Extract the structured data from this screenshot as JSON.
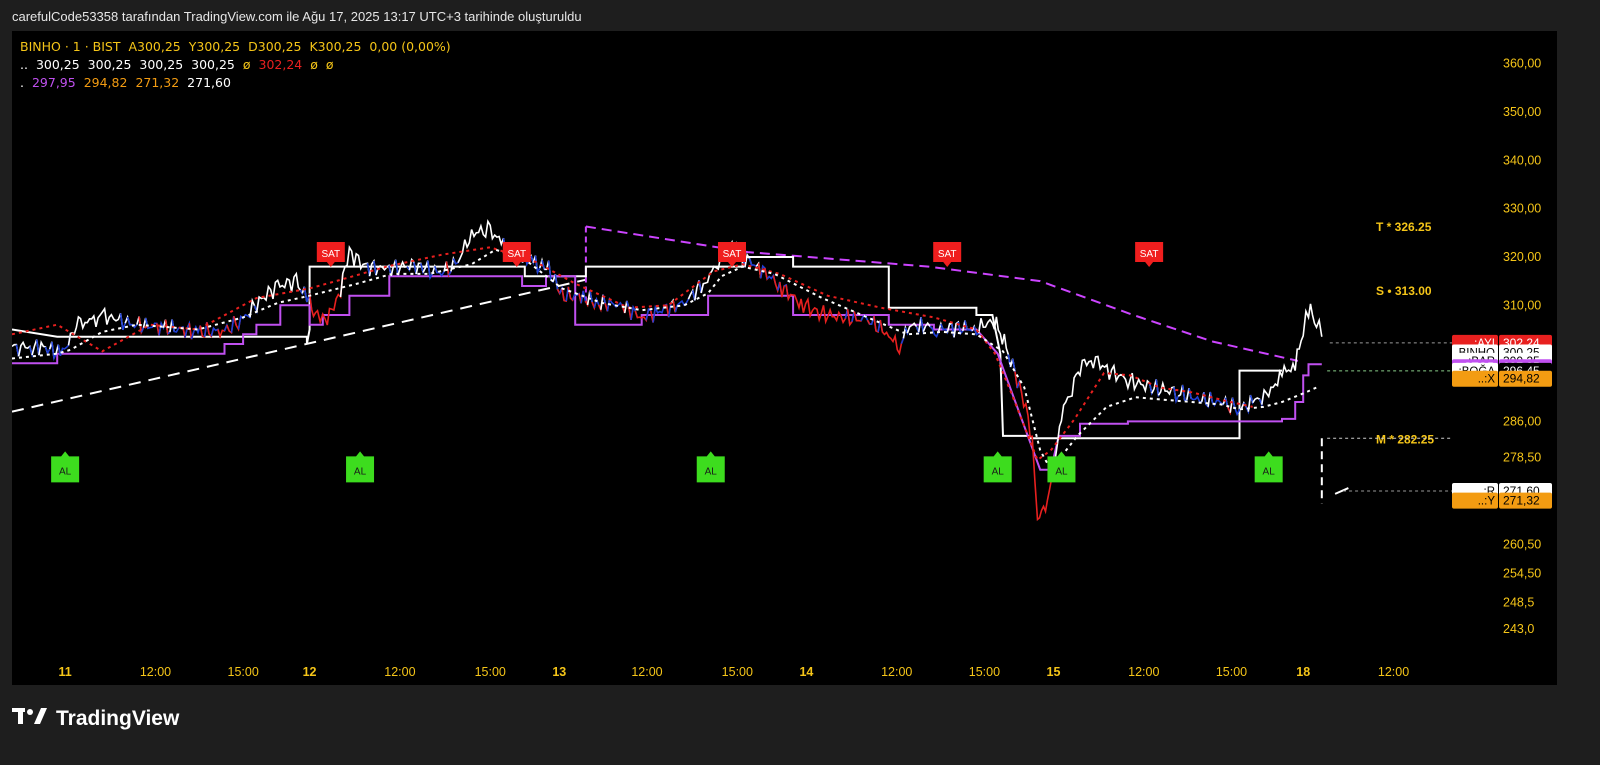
{
  "header": {
    "text": "carefulCode53358 tarafından TradingView.com ile Ağu 17, 2025 13:17 UTC+3 tarihinde oluşturuldu"
  },
  "legend": {
    "row1": {
      "symbol": "BINHO · 1 · BIST",
      "o": "A300,25",
      "h": "Y300,25",
      "l": "D300,25",
      "c": "K300,25",
      "chg": "0,00 (0,00%)"
    },
    "row2": {
      "prefix": "..",
      "v1": "300,25",
      "v2": "300,25",
      "v3": "300,25",
      "v4": "300,25",
      "na1": "ø",
      "v5": "302,24",
      "na2": "ø",
      "na3": "ø"
    },
    "row3": {
      "prefix": ".",
      "v1": "297,95",
      "v2": "294,82",
      "v3": "271,32",
      "v4": "271,60"
    }
  },
  "colors": {
    "up": "#ffffff",
    "down": "#e8201f",
    "neutral": "#1f3fd6",
    "stop": "#c050f0",
    "trend": "#cc44ff",
    "sell": "#f01e1e",
    "buy": "#3ddc1e",
    "yellow_text": "#f5c518",
    "orange": "#f39c12"
  },
  "brand": {
    "name": "TradingView",
    "icon": "tradingview-logo-icon"
  },
  "chart_data": {
    "type": "line",
    "symbol": "BINHO",
    "timeframe": "1",
    "exchange": "BIST",
    "ylim": [
      238.5,
      365.5
    ],
    "y_ticks": [
      "360,00",
      "350,00",
      "340,00",
      "330,00",
      "320,00",
      "310,00",
      "286,00",
      "278,50",
      "260,50",
      "254,50",
      "248,5",
      "243,0"
    ],
    "x_ticks": [
      "11",
      "12:00",
      "15:00",
      "12",
      "12:00",
      "15:00",
      "13",
      "12:00",
      "15:00",
      "14",
      "12:00",
      "15:00",
      "15",
      "12:00",
      "15:00",
      "18",
      "12:00"
    ],
    "x_tick_slots": [
      0.3,
      3.7,
      7,
      9.5,
      12.9,
      16.3,
      18.9,
      22.2,
      25.6,
      28.2,
      31.6,
      34.9,
      37.5,
      40.9,
      44.2,
      46.9,
      50.3
    ],
    "x_domain": [
      -1.7,
      52.5
    ],
    "price": [
      [
        -1.7,
        301.5
      ],
      [
        -1.2,
        300.8
      ],
      [
        -0.6,
        301.5
      ],
      [
        0.2,
        300.0
      ],
      [
        0.5,
        303.0
      ],
      [
        0.8,
        306.5
      ],
      [
        1.3,
        306.3
      ],
      [
        1.7,
        308.0
      ],
      [
        2.3,
        306.8
      ],
      [
        3.0,
        306.0
      ],
      [
        4.0,
        305.5
      ],
      [
        5.3,
        304.5
      ],
      [
        6.3,
        304.7
      ],
      [
        7.0,
        307.0
      ],
      [
        7.6,
        311.0
      ],
      [
        8.3,
        314.0
      ],
      [
        9.0,
        315.0
      ],
      [
        9.3,
        312.0
      ],
      [
        9.5,
        310.5
      ],
      [
        9.8,
        307.0
      ],
      [
        10.0,
        306.5
      ],
      [
        10.5,
        310.0
      ],
      [
        11.0,
        321.0
      ],
      [
        11.6,
        318.0
      ],
      [
        12.4,
        317.5
      ],
      [
        13.6,
        318.5
      ],
      [
        14.3,
        316.5
      ],
      [
        15.0,
        318.2
      ],
      [
        15.6,
        325.0
      ],
      [
        16.3,
        325.5
      ],
      [
        16.8,
        322.5
      ],
      [
        17.6,
        320.5
      ],
      [
        18.0,
        318.5
      ],
      [
        18.5,
        317.5
      ],
      [
        19.0,
        312.0
      ],
      [
        19.8,
        311.8
      ],
      [
        20.3,
        310.5
      ],
      [
        21.2,
        310.2
      ],
      [
        22.0,
        307.5
      ],
      [
        22.6,
        308.8
      ],
      [
        23.6,
        310.5
      ],
      [
        24.4,
        315.0
      ],
      [
        24.8,
        318.0
      ],
      [
        25.4,
        323.0
      ],
      [
        25.8,
        320.0
      ],
      [
        26.4,
        318.0
      ],
      [
        27.2,
        314.0
      ],
      [
        28.0,
        310.5
      ],
      [
        28.6,
        308.5
      ],
      [
        29.5,
        307.5
      ],
      [
        30.5,
        307.0
      ],
      [
        31.3,
        304.0
      ],
      [
        31.7,
        301.0
      ],
      [
        32.0,
        305.5
      ],
      [
        32.6,
        306.0
      ],
      [
        33.1,
        305.0
      ],
      [
        34.0,
        305.5
      ],
      [
        34.6,
        305.0
      ],
      [
        35.2,
        307.0
      ],
      [
        35.5,
        304.5
      ],
      [
        35.8,
        300.0
      ],
      [
        36.3,
        292.0
      ],
      [
        36.7,
        283.0
      ],
      [
        36.9,
        266.0
      ],
      [
        37.2,
        268.0
      ],
      [
        37.5,
        275.0
      ],
      [
        37.8,
        287.5
      ],
      [
        38.2,
        293.0
      ],
      [
        38.5,
        297.5
      ],
      [
        39.0,
        299.0
      ],
      [
        39.6,
        296.5
      ],
      [
        40.3,
        294.5
      ],
      [
        41.2,
        293.0
      ],
      [
        42.2,
        292.0
      ],
      [
        43.0,
        290.5
      ],
      [
        43.8,
        290.0
      ],
      [
        44.5,
        288.5
      ],
      [
        45.0,
        290.0
      ],
      [
        45.6,
        291.5
      ],
      [
        46.1,
        296.0
      ],
      [
        46.6,
        297.5
      ],
      [
        46.9,
        305.0
      ],
      [
        47.1,
        309.0
      ],
      [
        47.4,
        307.0
      ],
      [
        47.6,
        303.5
      ]
    ],
    "signal_line": [
      [
        -1.7,
        304.0
      ],
      [
        0.0,
        306.0
      ],
      [
        1.7,
        300.5
      ],
      [
        3.5,
        306.0
      ],
      [
        5.3,
        305.0
      ],
      [
        7.5,
        311.5
      ],
      [
        9.5,
        313.5
      ],
      [
        10.5,
        315.0
      ],
      [
        12.4,
        318.0
      ],
      [
        14.5,
        320.5
      ],
      [
        16.3,
        322.0
      ],
      [
        18.0,
        319.0
      ],
      [
        19.5,
        314.5
      ],
      [
        21.5,
        309.5
      ],
      [
        23.0,
        310.0
      ],
      [
        24.7,
        317.0
      ],
      [
        25.8,
        318.5
      ],
      [
        27.2,
        316.5
      ],
      [
        29.0,
        312.0
      ],
      [
        31.0,
        309.5
      ],
      [
        33.0,
        307.5
      ],
      [
        34.6,
        305.0
      ],
      [
        35.3,
        300.0
      ],
      [
        35.9,
        292.0
      ],
      [
        36.4,
        285.0
      ],
      [
        36.9,
        278.0
      ],
      [
        37.4,
        280.0
      ],
      [
        38.3,
        286.5
      ],
      [
        39.4,
        296.0
      ],
      [
        40.4,
        295.5
      ],
      [
        41.5,
        293.0
      ],
      [
        42.7,
        292.0
      ],
      [
        44.0,
        290.2
      ],
      [
        45.0,
        289.0
      ]
    ],
    "ema_line": [
      [
        -1.7,
        299.0
      ],
      [
        0.0,
        300.0
      ],
      [
        0.5,
        300.8
      ],
      [
        1.7,
        304.5
      ],
      [
        3.0,
        306.0
      ],
      [
        5.3,
        305.0
      ],
      [
        7.0,
        307.5
      ],
      [
        8.3,
        310.5
      ],
      [
        9.5,
        312.0
      ],
      [
        11.3,
        314.5
      ],
      [
        12.6,
        316.5
      ],
      [
        14.0,
        316.5
      ],
      [
        15.6,
        318.5
      ],
      [
        16.5,
        321.5
      ],
      [
        17.6,
        319.5
      ],
      [
        19.0,
        313.5
      ],
      [
        20.5,
        310.5
      ],
      [
        22.0,
        309.0
      ],
      [
        23.6,
        310.0
      ],
      [
        24.5,
        312.5
      ],
      [
        25.0,
        316.0
      ],
      [
        25.8,
        318.0
      ],
      [
        27.0,
        316.5
      ],
      [
        28.8,
        311.5
      ],
      [
        30.5,
        307.5
      ],
      [
        32.0,
        304.0
      ],
      [
        33.3,
        304.5
      ],
      [
        34.6,
        304.0
      ],
      [
        35.6,
        300.5
      ],
      [
        36.4,
        293.0
      ],
      [
        37.0,
        280.0
      ],
      [
        37.4,
        276.0
      ],
      [
        38.4,
        283.0
      ],
      [
        39.5,
        289.0
      ],
      [
        40.6,
        291.0
      ],
      [
        41.6,
        290.5
      ],
      [
        42.7,
        290.0
      ],
      [
        43.8,
        289.5
      ],
      [
        44.5,
        288.5
      ],
      [
        45.4,
        289.0
      ],
      [
        46.1,
        290.0
      ],
      [
        47.0,
        292.0
      ],
      [
        47.4,
        293.0
      ]
    ],
    "trend_line": [
      [
        -1.7,
        288.0
      ],
      [
        19.9,
        315.3
      ]
    ],
    "descending_line": [
      [
        19.9,
        326.3
      ],
      [
        26.0,
        321.0
      ],
      [
        32.8,
        318.0
      ],
      [
        37.0,
        315.0
      ],
      [
        40.5,
        308.0
      ],
      [
        43.5,
        302.5
      ],
      [
        46.7,
        298.5
      ]
    ],
    "upper_step": [
      [
        -1.7,
        305.0
      ],
      [
        0.0,
        303.5
      ],
      [
        0.0,
        303.5
      ],
      [
        9.4,
        303.5
      ],
      [
        9.4,
        302.0
      ],
      [
        9.5,
        305.0
      ],
      [
        9.5,
        318.0
      ],
      [
        17.6,
        318.0
      ],
      [
        17.6,
        316.0
      ],
      [
        19.9,
        316.0
      ],
      [
        19.9,
        318.0
      ],
      [
        25.8,
        318.0
      ],
      [
        25.8,
        320.0
      ],
      [
        27.7,
        320.0
      ],
      [
        27.7,
        318.0
      ],
      [
        31.3,
        318.0
      ],
      [
        31.3,
        309.5
      ],
      [
        34.6,
        309.5
      ],
      [
        34.6,
        308.0
      ],
      [
        35.2,
        308.0
      ],
      [
        35.5,
        300.0
      ],
      [
        35.6,
        283.0
      ],
      [
        36.6,
        283.0
      ],
      [
        36.6,
        282.5
      ],
      [
        37.2,
        282.5
      ],
      [
        44.5,
        282.5
      ],
      [
        44.5,
        296.5
      ],
      [
        46.1,
        296.5
      ]
    ],
    "stop_step": [
      [
        -1.7,
        298.0
      ],
      [
        0.0,
        298.0
      ],
      [
        0.0,
        300.0
      ],
      [
        6.3,
        300.0
      ],
      [
        6.3,
        302.0
      ],
      [
        7.0,
        302.0
      ],
      [
        7.0,
        304.0
      ],
      [
        7.5,
        304.0
      ],
      [
        7.5,
        306.0
      ],
      [
        8.4,
        306.0
      ],
      [
        8.4,
        310.0
      ],
      [
        9.5,
        310.0
      ],
      [
        9.5,
        306.0
      ],
      [
        10.0,
        306.0
      ],
      [
        10.0,
        308.0
      ],
      [
        11.0,
        308.0
      ],
      [
        11.0,
        312.0
      ],
      [
        12.5,
        312.0
      ],
      [
        12.5,
        316.0
      ],
      [
        17.5,
        316.0
      ],
      [
        17.5,
        314.0
      ],
      [
        18.4,
        314.0
      ],
      [
        18.4,
        316.0
      ],
      [
        19.5,
        316.0
      ],
      [
        19.5,
        306.0
      ],
      [
        22.0,
        306.0
      ],
      [
        22.0,
        308.0
      ],
      [
        24.5,
        308.0
      ],
      [
        24.5,
        312.0
      ],
      [
        27.7,
        312.0
      ],
      [
        27.7,
        308.0
      ],
      [
        31.3,
        308.0
      ],
      [
        31.3,
        306.0
      ],
      [
        33.0,
        306.0
      ],
      [
        33.0,
        305.0
      ],
      [
        34.6,
        305.0
      ],
      [
        35.0,
        302.5
      ],
      [
        35.4,
        300.0
      ],
      [
        37.0,
        276.0
      ],
      [
        37.4,
        276.0
      ],
      [
        37.7,
        283.0
      ],
      [
        38.5,
        283.0
      ],
      [
        38.5,
        285.5
      ],
      [
        40.3,
        285.5
      ],
      [
        40.3,
        286.0
      ],
      [
        46.1,
        286.0
      ],
      [
        46.1,
        286.5
      ],
      [
        46.6,
        286.5
      ],
      [
        46.6,
        290.0
      ],
      [
        46.9,
        290.0
      ],
      [
        46.9,
        295.5
      ],
      [
        47.1,
        295.5
      ],
      [
        47.1,
        297.8
      ],
      [
        47.6,
        297.8
      ]
    ],
    "sell_signals": [
      {
        "x": 10.3,
        "label": "SAT"
      },
      {
        "x": 17.3,
        "label": "SAT"
      },
      {
        "x": 25.4,
        "label": "SAT"
      },
      {
        "x": 33.5,
        "label": "SAT"
      },
      {
        "x": 41.1,
        "label": "SAT"
      }
    ],
    "buy_signals": [
      {
        "x": 0.3,
        "label": "AL"
      },
      {
        "x": 11.4,
        "label": "AL"
      },
      {
        "x": 24.6,
        "label": "AL"
      },
      {
        "x": 35.4,
        "label": "AL"
      },
      {
        "x": 37.8,
        "label": "AL"
      },
      {
        "x": 45.6,
        "label": "AL"
      }
    ],
    "annotations": [
      {
        "label": "T * 326.25",
        "price": 326.25,
        "color": "#f5c518"
      },
      {
        "label": "S • 313.00",
        "price": 313.0,
        "color": "#f5c518"
      },
      {
        "label": "M * 282.25",
        "price": 282.25,
        "color": "#f5c518"
      }
    ],
    "price_labels": [
      {
        "name": "..:AYI",
        "value": "302,24",
        "price": 302.24,
        "bg": "#e8201f",
        "fg": "#ffffff",
        "val_bg": "#e8201f",
        "val_fg": "#ffffff"
      },
      {
        "name": "BINHO",
        "value": "300,25",
        "price": 300.25,
        "bg": "#ffffff",
        "fg": "#000000",
        "val_bg": "#ffffff",
        "val_fg": "#000000"
      },
      {
        "name": "..:BAR",
        "value": "300,25",
        "price": 298.5,
        "bg": "#ffffff",
        "fg": "#000000",
        "val_bg": "#ffffff",
        "val_fg": "#000000"
      },
      {
        "name": "..:STOP",
        "value": "297,95",
        "price": 297.2,
        "bg": "#c050f0",
        "fg": "#ffffff",
        "val_bg": "#c050f0",
        "val_fg": "#ffffff"
      },
      {
        "name": "..:BOĞA",
        "value": "296,45",
        "price": 296.45,
        "bg": "#ffffff",
        "fg": "#000000",
        "val_bg": "#000000",
        "val_fg": "#ffffff"
      },
      {
        "name": "..:X",
        "value": "294,82",
        "price": 294.82,
        "bg": "#f39c12",
        "fg": "#000000",
        "val_bg": "#f39c12",
        "val_fg": "#000000"
      },
      {
        "name": "..:R",
        "value": "271,60",
        "price": 271.6,
        "bg": "#ffffff",
        "fg": "#000000",
        "val_bg": "#ffffff",
        "val_fg": "#000000"
      },
      {
        "name": "..:Y",
        "value": "271,32",
        "price": 269.6,
        "bg": "#f39c12",
        "fg": "#000000",
        "val_bg": "#f39c12",
        "val_fg": "#000000"
      }
    ]
  }
}
